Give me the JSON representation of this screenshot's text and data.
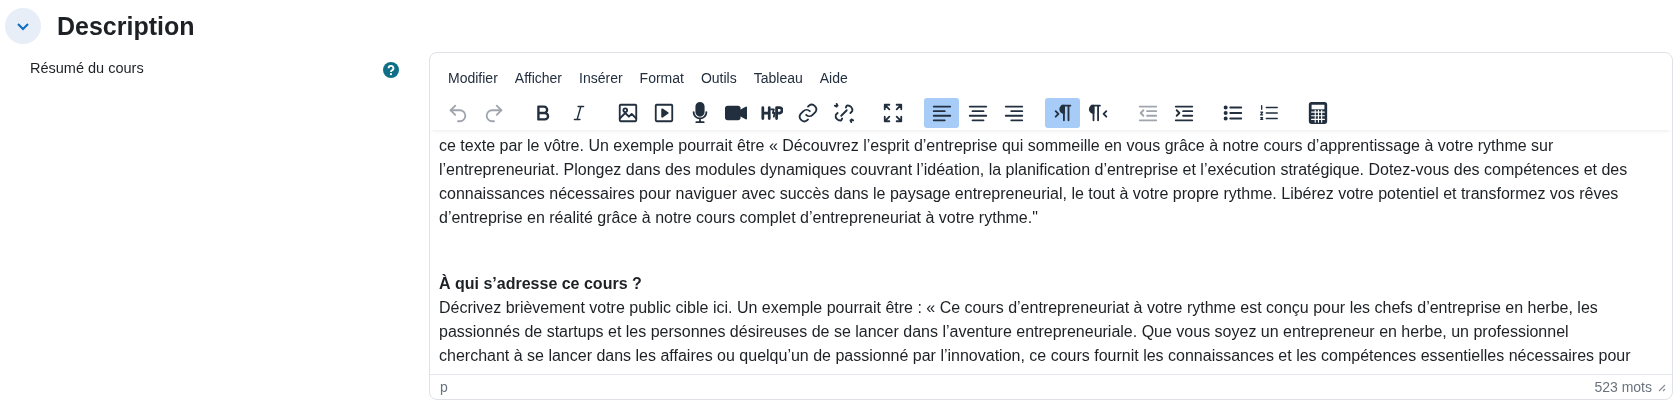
{
  "section": {
    "title": "Description",
    "expanded": true
  },
  "field": {
    "label": "Résumé du cours"
  },
  "editor": {
    "menu": [
      "Modifier",
      "Afficher",
      "Insérer",
      "Format",
      "Outils",
      "Tableau",
      "Aide"
    ],
    "toolbar": [
      [
        {
          "kind": "undo",
          "selected": false,
          "disabled": true
        },
        {
          "kind": "redo",
          "selected": false,
          "disabled": true
        }
      ],
      [
        {
          "kind": "bold",
          "selected": false,
          "disabled": false
        },
        {
          "kind": "italic",
          "selected": false,
          "disabled": false
        }
      ],
      [
        {
          "kind": "image",
          "selected": false,
          "disabled": false
        },
        {
          "kind": "media",
          "selected": false,
          "disabled": false
        },
        {
          "kind": "microphone",
          "selected": false,
          "disabled": false
        },
        {
          "kind": "video",
          "selected": false,
          "disabled": false
        },
        {
          "kind": "h5p",
          "selected": false,
          "disabled": false
        },
        {
          "kind": "link",
          "selected": false,
          "disabled": false
        },
        {
          "kind": "unlink",
          "selected": false,
          "disabled": false
        }
      ],
      [
        {
          "kind": "fullscreen",
          "selected": false,
          "disabled": false
        }
      ],
      [
        {
          "kind": "align-left",
          "selected": true,
          "disabled": false
        },
        {
          "kind": "align-center",
          "selected": false,
          "disabled": false
        },
        {
          "kind": "align-right",
          "selected": false,
          "disabled": false
        }
      ],
      [
        {
          "kind": "ltr",
          "selected": true,
          "disabled": false
        },
        {
          "kind": "rtl",
          "selected": false,
          "disabled": false
        }
      ],
      [
        {
          "kind": "outdent",
          "selected": false,
          "disabled": true
        },
        {
          "kind": "indent",
          "selected": false,
          "disabled": false
        }
      ],
      [
        {
          "kind": "bullet-list",
          "selected": false,
          "disabled": false
        },
        {
          "kind": "numbered-list",
          "selected": false,
          "disabled": false
        }
      ],
      [
        {
          "kind": "calculator",
          "selected": false,
          "disabled": false
        }
      ]
    ],
    "content": [
      {
        "kind": "paragraph",
        "lines": [
          "ce texte par le vôtre. Un exemple pourrait être « Découvrez l’esprit d’entreprise qui sommeille en vous grâce à notre cours d’apprentissage à votre rythme sur",
          "l’entrepreneuriat. Plongez dans des modules dynamiques couvrant l’idéation, la planification d’entreprise et l’exécution stratégique. Dotez-vous des compétences et des",
          "connaissances nécessaires pour naviguer avec succès dans le paysage entrepreneurial, le tout à votre propre rythme. Libérez votre potentiel et transformez vos rêves",
          "d’entreprise en réalité grâce à notre cours complet d’entrepreneuriat à votre rythme.\""
        ]
      },
      {
        "kind": "empty"
      },
      {
        "kind": "heading",
        "lines": [
          "À qui s’adresse ce cours ?"
        ]
      },
      {
        "kind": "paragraph",
        "lines": [
          "Décrivez brièvement votre public cible ici. Un exemple pourrait être : « Ce cours d’entrepreneuriat à votre rythme est conçu pour les chefs d’entreprise en herbe, les",
          "passionnés de startups et les personnes désireuses de se lancer dans l’aventure entrepreneuriale. Que vous soyez un entrepreneur en herbe, un professionnel",
          "cherchant à se lancer dans les affaires ou quelqu’un de passionné par l’innovation, ce cours fournit les connaissances et les compétences essentielles nécessaires pour"
        ]
      }
    ],
    "status_path": "p",
    "word_count": "523 mots"
  }
}
